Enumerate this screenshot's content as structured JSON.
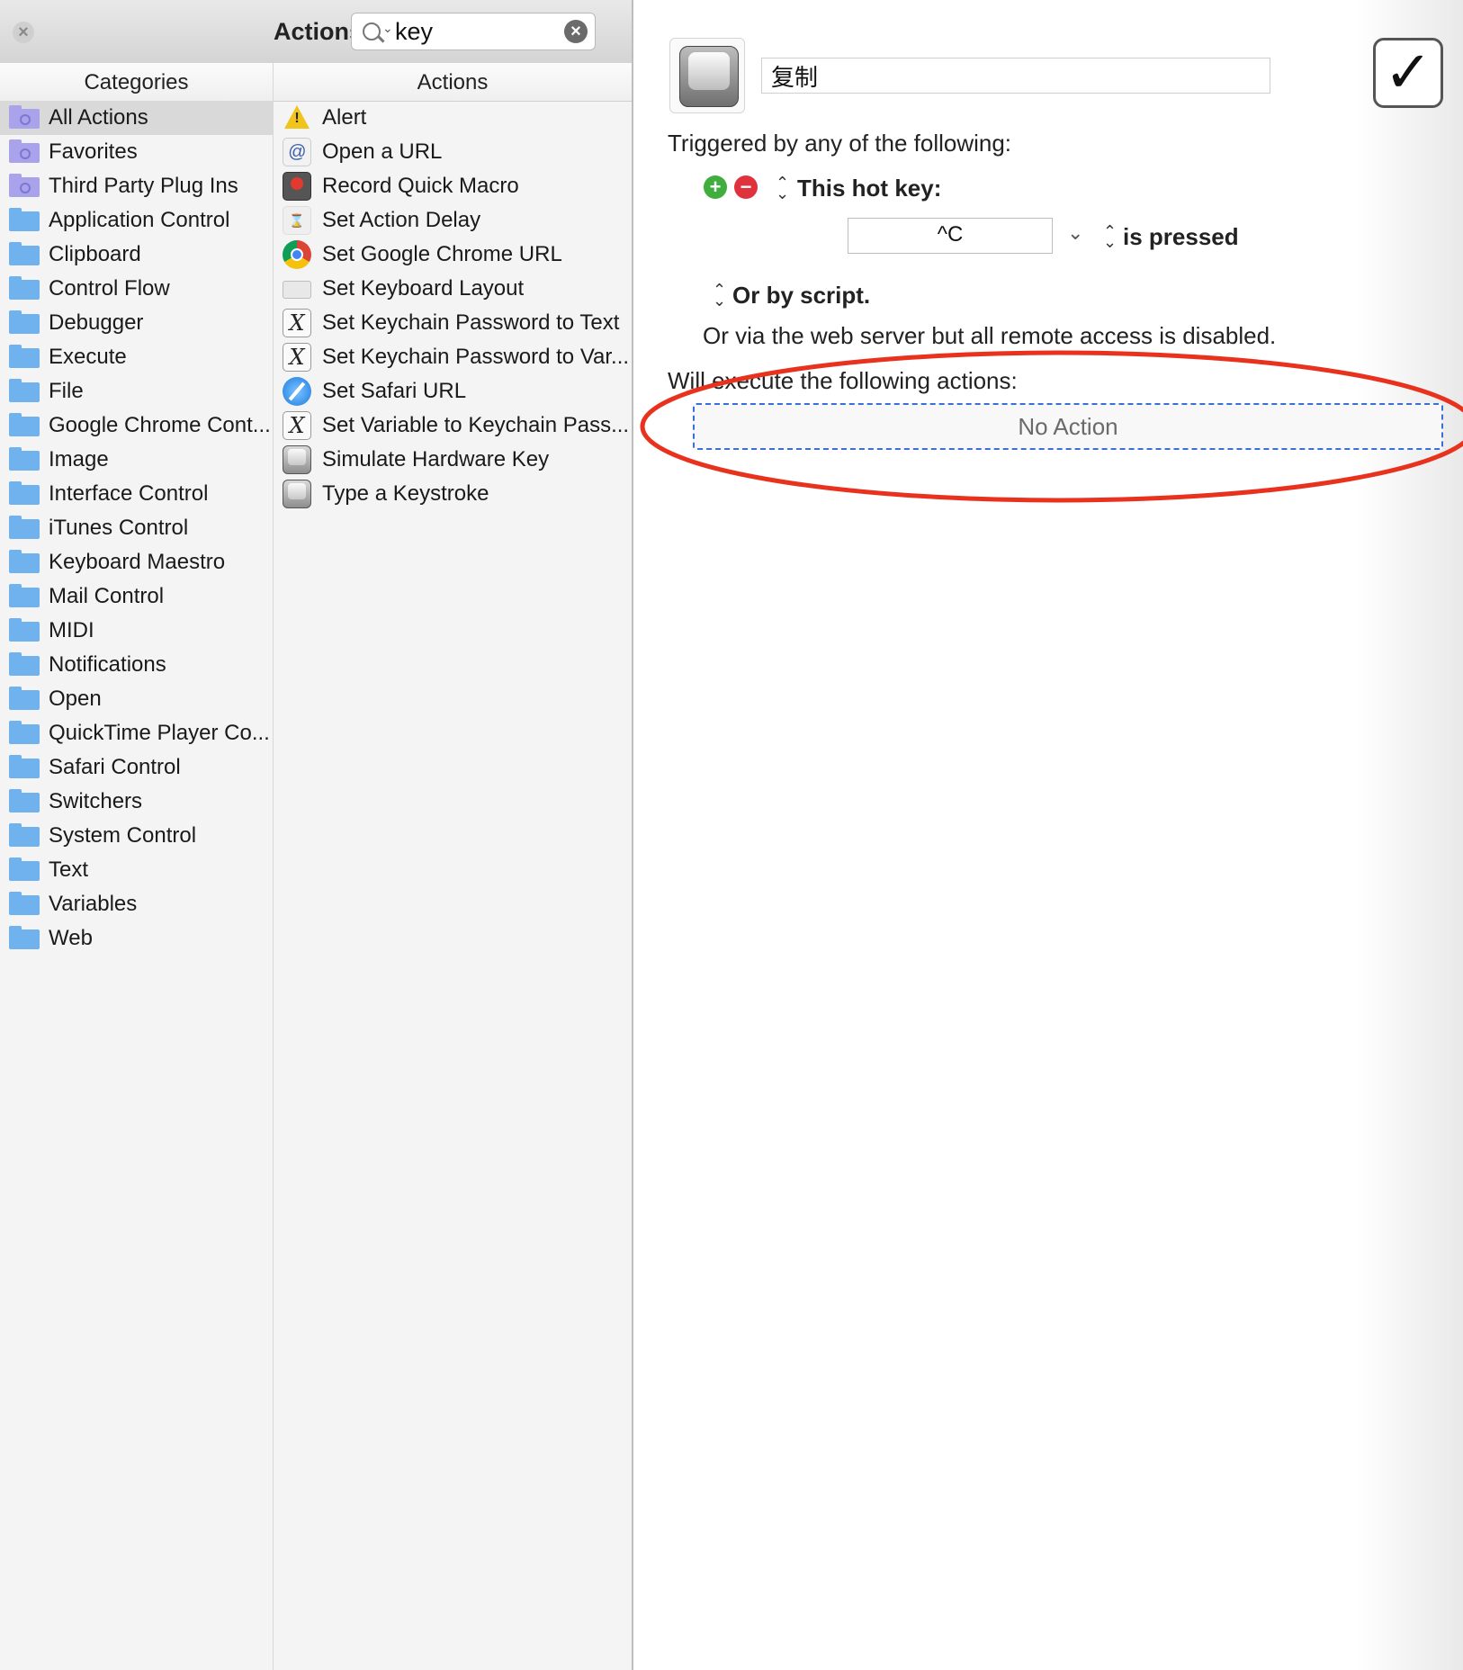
{
  "palette": {
    "title": "Actions",
    "search": {
      "value": "key"
    },
    "headers": {
      "categories": "Categories",
      "actions": "Actions"
    },
    "categories": [
      {
        "label": "All Actions",
        "icon": "smart-folder-icon",
        "selected": true
      },
      {
        "label": "Favorites",
        "icon": "smart-folder-icon"
      },
      {
        "label": "Third Party Plug Ins",
        "icon": "smart-folder-icon"
      },
      {
        "label": "Application Control",
        "icon": "folder-icon"
      },
      {
        "label": "Clipboard",
        "icon": "folder-icon"
      },
      {
        "label": "Control Flow",
        "icon": "folder-icon"
      },
      {
        "label": "Debugger",
        "icon": "folder-icon"
      },
      {
        "label": "Execute",
        "icon": "folder-icon"
      },
      {
        "label": "File",
        "icon": "folder-icon"
      },
      {
        "label": "Google Chrome Cont...",
        "icon": "folder-icon"
      },
      {
        "label": "Image",
        "icon": "folder-icon"
      },
      {
        "label": "Interface Control",
        "icon": "folder-icon"
      },
      {
        "label": "iTunes Control",
        "icon": "folder-icon"
      },
      {
        "label": "Keyboard Maestro",
        "icon": "folder-icon"
      },
      {
        "label": "Mail Control",
        "icon": "folder-icon"
      },
      {
        "label": "MIDI",
        "icon": "folder-icon"
      },
      {
        "label": "Notifications",
        "icon": "folder-icon"
      },
      {
        "label": "Open",
        "icon": "folder-icon"
      },
      {
        "label": "QuickTime Player Co...",
        "icon": "folder-icon"
      },
      {
        "label": "Safari Control",
        "icon": "folder-icon"
      },
      {
        "label": "Switchers",
        "icon": "folder-icon"
      },
      {
        "label": "System Control",
        "icon": "folder-icon"
      },
      {
        "label": "Text",
        "icon": "folder-icon"
      },
      {
        "label": "Variables",
        "icon": "folder-icon"
      },
      {
        "label": "Web",
        "icon": "folder-icon"
      }
    ],
    "actions": [
      {
        "label": "Alert",
        "icon": "alert-icon"
      },
      {
        "label": "Open a URL",
        "icon": "url-icon"
      },
      {
        "label": "Record Quick Macro",
        "icon": "record-icon"
      },
      {
        "label": "Set Action Delay",
        "icon": "delay-icon"
      },
      {
        "label": "Set Google Chrome URL",
        "icon": "chrome-icon"
      },
      {
        "label": "Set Keyboard Layout",
        "icon": "keyboard-icon"
      },
      {
        "label": "Set Keychain Password to Text",
        "icon": "variable-x-icon"
      },
      {
        "label": "Set Keychain Password to Var...",
        "icon": "variable-x-icon"
      },
      {
        "label": "Set Safari URL",
        "icon": "safari-icon"
      },
      {
        "label": "Set Variable to Keychain Pass...",
        "icon": "variable-x-icon"
      },
      {
        "label": "Simulate Hardware Key",
        "icon": "key-icon"
      },
      {
        "label": "Type a Keystroke",
        "icon": "key-icon"
      }
    ]
  },
  "editor": {
    "macro_name": "复制",
    "enabled_mark": "✓",
    "triggered_label": "Triggered by any of the following:",
    "trigger_type": "This hot key:",
    "hotkey": "^C",
    "pressed_label": "is pressed",
    "script_label": "Or by script.",
    "webserver_label": "Or via the web server but all remote access is disabled.",
    "execute_label": "Will execute the following actions:",
    "no_action": "No Action"
  },
  "colors": {
    "annotation": "#e8321e",
    "drop_zone_border": "#3a6fd8",
    "folder": "#6fb2ee",
    "smart_folder": "#a8a3ea",
    "add": "#3fae3f",
    "remove": "#e0323c"
  }
}
